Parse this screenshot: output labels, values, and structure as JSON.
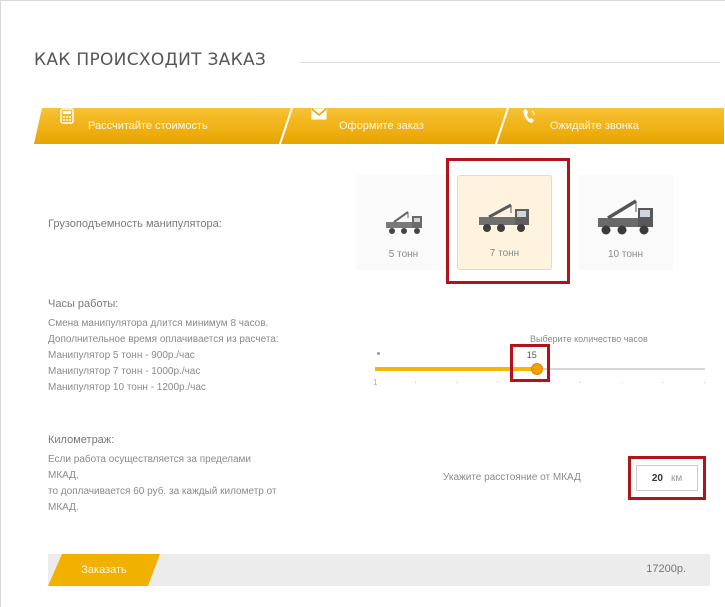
{
  "title": "КАК ПРОИСХОДИТ ЗАКАЗ",
  "steps": [
    {
      "label": "Рассчитайте стоимость",
      "icon": "calculator-icon"
    },
    {
      "label": "Оформите заказ",
      "icon": "envelope-icon"
    },
    {
      "label": "Ожидайте звонка",
      "icon": "phone-icon"
    }
  ],
  "capacity": {
    "label": "Грузоподъемность манипулятора:",
    "options": [
      {
        "label": "5 тонн",
        "selected": false
      },
      {
        "label": "7 тонн",
        "selected": true
      },
      {
        "label": "10 тонн",
        "selected": false
      }
    ]
  },
  "hours": {
    "title": "Часы работы:",
    "lines": [
      "Смена манипулятора длится минимум 8 часов.",
      "Дополнительное время оплачивается из расчета:",
      "Манипулятор 5 тонн - 900р./час",
      "Манипулятор 7 тонн - 1000р./час",
      "Манипулятор 10 тонн - 1200р./час"
    ],
    "slider_hint": "Выберите количество часов",
    "slider_value": "15",
    "slider_fraction": 0.49,
    "tick_labels": [
      "1",
      "",
      "",
      "",
      "",
      "",
      "",
      "",
      ""
    ]
  },
  "km": {
    "title": "Километраж:",
    "lines": [
      "Если работа осуществляется за пределами",
      "МКАД,",
      "то доплачивается 60 руб. за каждый километр от",
      "МКАД."
    ],
    "input_label": "Укажите расстояние от МКАД",
    "value": "20",
    "unit": "км"
  },
  "bottom": {
    "order_label": "Заказать",
    "total": "17200р."
  },
  "colors": {
    "accent": "#f2b705",
    "accent_dark": "#e39a00",
    "highlight": "#b1131b"
  }
}
